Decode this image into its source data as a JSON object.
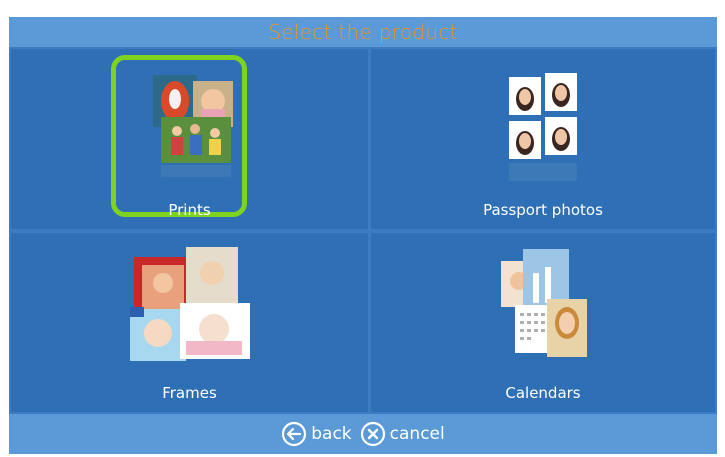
{
  "title": "Select the product",
  "products": [
    {
      "label": "Prints",
      "icon": "prints-collage-icon",
      "selected": true
    },
    {
      "label": "Passport photos",
      "icon": "passport-photos-icon",
      "selected": false
    },
    {
      "label": "Frames",
      "icon": "frames-collage-icon",
      "selected": false
    },
    {
      "label": "Calendars",
      "icon": "calendars-icon",
      "selected": false
    }
  ],
  "footer": {
    "back_label": "back",
    "cancel_label": "cancel"
  },
  "colors": {
    "panel": "#3d7cc0",
    "tile": "#2e6fb5",
    "bar": "#5b9ad6",
    "title_text": "#e8962a",
    "selection": "#7ed321"
  }
}
